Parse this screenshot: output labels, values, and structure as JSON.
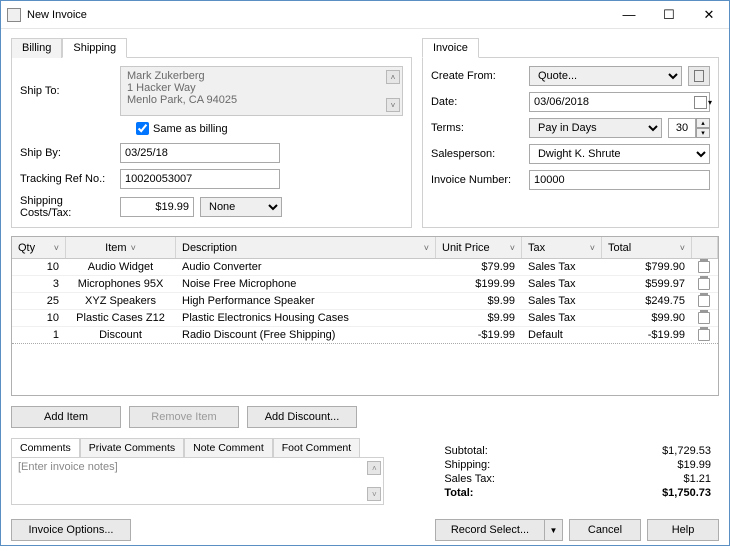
{
  "window": {
    "title": "New Invoice"
  },
  "ship_tabs": {
    "billing": "Billing",
    "shipping": "Shipping"
  },
  "shipping": {
    "ship_to_label": "Ship To:",
    "address_line1": "Mark Zukerberg",
    "address_line2": "1 Hacker Way",
    "address_line3": "Menlo Park, CA 94025",
    "same_as_billing_label": "Same as billing",
    "ship_by_label": "Ship By:",
    "ship_by": "03/25/18",
    "trackref_label": "Tracking Ref No.:",
    "trackref": "10020053007",
    "shipcost_label": "Shipping Costs/Tax:",
    "shipcost": "$19.99",
    "shiptax": "None"
  },
  "invoice_tab": {
    "label": "Invoice"
  },
  "invoice": {
    "create_from_label": "Create From:",
    "create_from": "Quote...",
    "date_label": "Date:",
    "date": "03/06/2018",
    "terms_label": "Terms:",
    "terms": "Pay in Days",
    "terms_days": "30",
    "salesperson_label": "Salesperson:",
    "salesperson": "Dwight K. Shrute",
    "invno_label": "Invoice Number:",
    "invno": "10000"
  },
  "grid": {
    "headers": {
      "qty": "Qty",
      "item": "Item",
      "desc": "Description",
      "up": "Unit Price",
      "tax": "Tax",
      "total": "Total"
    },
    "rows": [
      {
        "qty": "10",
        "item": "Audio Widget",
        "desc": "Audio Converter",
        "up": "$79.99",
        "tax": "Sales Tax",
        "total": "$799.90"
      },
      {
        "qty": "3",
        "item": "Microphones 95X",
        "desc": "Noise Free Microphone",
        "up": "$199.99",
        "tax": "Sales Tax",
        "total": "$599.97"
      },
      {
        "qty": "25",
        "item": "XYZ Speakers",
        "desc": "High Performance Speaker",
        "up": "$9.99",
        "tax": "Sales Tax",
        "total": "$249.75"
      },
      {
        "qty": "10",
        "item": "Plastic Cases Z12",
        "desc": "Plastic Electronics Housing Cases",
        "up": "$9.99",
        "tax": "Sales Tax",
        "total": "$99.90"
      },
      {
        "qty": "1",
        "item": "Discount",
        "desc": "Radio Discount (Free Shipping)",
        "up": "-$19.99",
        "tax": "Default",
        "total": "-$19.99"
      }
    ]
  },
  "buttons": {
    "add_item": "Add Item",
    "remove_item": "Remove Item",
    "add_discount": "Add Discount..."
  },
  "comment_tabs": {
    "comments": "Comments",
    "private": "Private Comments",
    "note": "Note Comment",
    "foot": "Foot Comment"
  },
  "comments": {
    "placeholder": "[Enter invoice notes]"
  },
  "totals": {
    "subtotal_label": "Subtotal:",
    "subtotal": "$1,729.53",
    "shipping_label": "Shipping:",
    "shipping": "$19.99",
    "salestax_label": "Sales Tax:",
    "salestax": "$1.21",
    "total_label": "Total:",
    "total": "$1,750.73"
  },
  "footer": {
    "options": "Invoice Options...",
    "record": "Record Select...",
    "cancel": "Cancel",
    "help": "Help"
  }
}
